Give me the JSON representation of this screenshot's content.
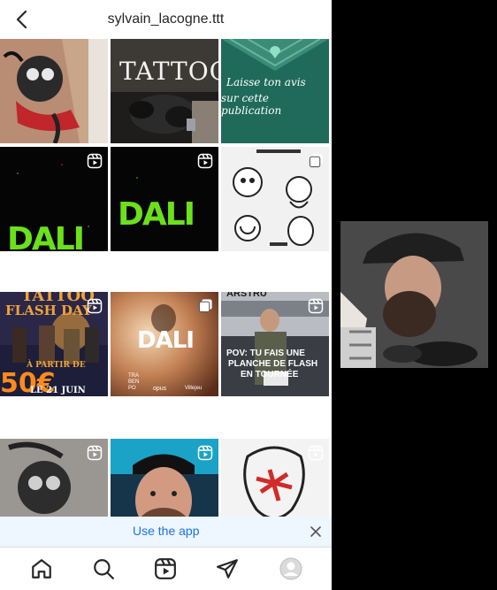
{
  "header": {
    "title": "sylvain_lacogne.ttt",
    "back_icon": "chevron-left-icon"
  },
  "grid": {
    "tiles": [
      {
        "type": "image",
        "label": ""
      },
      {
        "type": "image",
        "label": "TATTOO"
      },
      {
        "type": "image",
        "label": "Laisse ton avis sur cette publication"
      },
      {
        "type": "reel",
        "label": "DALI"
      },
      {
        "type": "reel",
        "label": "DALI"
      },
      {
        "type": "carousel",
        "label": ""
      },
      {
        "type": "reel",
        "label": "TATTOO FLASH DAY"
      },
      {
        "type": "carousel",
        "label": "DALI"
      },
      {
        "type": "reel",
        "label": "POV: TU FAIS UNE PLANCHE DE FLASH EN TOURNÉE"
      },
      {
        "type": "reel",
        "label": ""
      },
      {
        "type": "reel",
        "label": ""
      },
      {
        "type": "reel",
        "label": ""
      }
    ],
    "tile_texts": {
      "t2": "TATTOO",
      "t3a": "Laisse ton avis",
      "t3b": "sur cette publication",
      "t4": "DALI",
      "t5": "DALI",
      "t7a": "TATTOO",
      "t7b": "FLASH DAY",
      "t7c": "À PARTIR DE",
      "t7d": "50€",
      "t7e": "LE 21 JUIN",
      "t8": "DALI",
      "t8b": "TRA BEN PO",
      "t8c": "opus",
      "t8d": "Villejeu",
      "t9a": "POV: TU FAIS UNE",
      "t9b": "PLANCHE DE FLASH",
      "t9c": "EN TOURNÉE",
      "t9d": "ARSTRU"
    }
  },
  "banner": {
    "label": "Use the app",
    "close_icon": "close-icon"
  },
  "bottom_nav": {
    "items": [
      {
        "name": "home-icon"
      },
      {
        "name": "search-icon"
      },
      {
        "name": "reels-icon"
      },
      {
        "name": "direct-icon"
      },
      {
        "name": "profile-avatar-icon"
      }
    ]
  },
  "colors": {
    "link": "#1a73e8",
    "banner_bg": "#eef6ff",
    "text": "#262626",
    "dali_green": "#6be01b"
  }
}
